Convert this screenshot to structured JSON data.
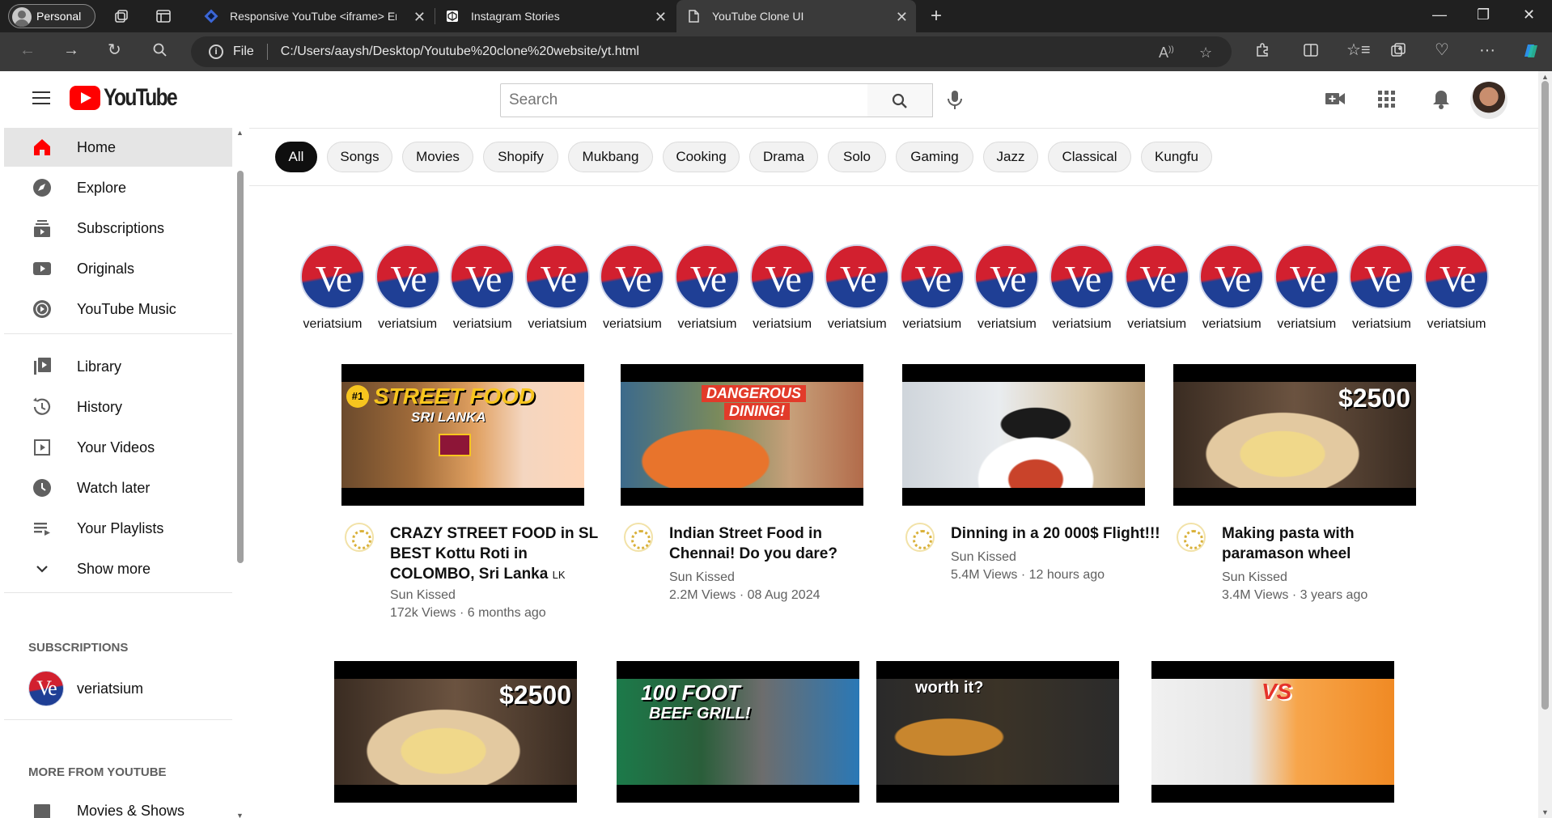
{
  "browser": {
    "profile": "Personal",
    "tabs": [
      {
        "title": "Responsive YouTube <iframe> Er"
      },
      {
        "title": "Instagram Stories"
      },
      {
        "title": "YouTube Clone UI"
      }
    ],
    "address": {
      "scheme_label": "File",
      "url": "C:/Users/aaysh/Desktop/Youtube%20clone%20website/yt.html"
    }
  },
  "header": {
    "logo_text": "YouTube",
    "search": {
      "placeholder": "Search",
      "value": ""
    }
  },
  "sidebar": {
    "main": [
      {
        "label": "Home",
        "icon": "home-icon",
        "active": true
      },
      {
        "label": "Explore",
        "icon": "compass-icon"
      },
      {
        "label": "Subscriptions",
        "icon": "subscriptions-icon"
      },
      {
        "label": "Originals",
        "icon": "originals-icon"
      },
      {
        "label": "YouTube Music",
        "icon": "music-icon"
      }
    ],
    "library": [
      {
        "label": "Library",
        "icon": "library-icon"
      },
      {
        "label": "History",
        "icon": "history-icon"
      },
      {
        "label": "Your Videos",
        "icon": "your-videos-icon"
      },
      {
        "label": "Watch later",
        "icon": "clock-icon"
      },
      {
        "label": "Your Playlists",
        "icon": "playlist-icon"
      },
      {
        "label": "Show more",
        "icon": "chevron-down-icon"
      }
    ],
    "subscriptions_heading": "SUBSCRIPTIONS",
    "subscription_channel": "veriatsium",
    "more_heading": "MORE FROM YOUTUBE",
    "more_item_partial": "Movies & Shows"
  },
  "chips": [
    "All",
    "Songs",
    "Movies",
    "Shopify",
    "Mukbang",
    "Cooking",
    "Drama",
    "Solo",
    "Gaming",
    "Jazz",
    "Classical",
    "Kungfu"
  ],
  "stories": {
    "avatar_text": "Ve",
    "names": [
      "veriatsium",
      "veriatsium",
      "veriatsium",
      "veriatsium",
      "veriatsium",
      "veriatsium",
      "veriatsium",
      "veriatsium",
      "veriatsium",
      "veriatsium",
      "veriatsium",
      "veriatsium",
      "veriatsium",
      "veriatsium",
      "veriatsium",
      "veriatsium"
    ]
  },
  "videos": [
    {
      "title": "CRAZY STREET FOOD in SL BEST Kottu Roti in COLOMBO, Sri Lanka",
      "flag": "LK",
      "channel": "Sun Kissed",
      "stats": "172k Views · 6 months ago",
      "thumb_caption": "STREET FOOD",
      "thumb_caption2": "SRI LANKA",
      "thumb_badge": "#1"
    },
    {
      "title": "Indian Street Food in Chennai! Do you dare?",
      "channel": "Sun Kissed",
      "stats": "2.2M Views · 08 Aug 2024",
      "thumb_caption": "DANGEROUS",
      "thumb_caption2": "DINING!"
    },
    {
      "title": "Dinning in a 20 000$ Flight!!!",
      "channel": "Sun Kissed",
      "stats": "5.4M Views · 12 hours ago"
    },
    {
      "title": "Making pasta with paramason wheel",
      "channel": "Sun Kissed",
      "stats": "3.4M Views · 3 years ago",
      "thumb_caption": "$2500"
    }
  ],
  "row2_thumbs": [
    {
      "caption": "$2500"
    },
    {
      "caption": "100 FOOT",
      "caption2": "BEEF GRILL!"
    },
    {
      "caption": "worth it?"
    },
    {
      "caption": "VS"
    }
  ]
}
